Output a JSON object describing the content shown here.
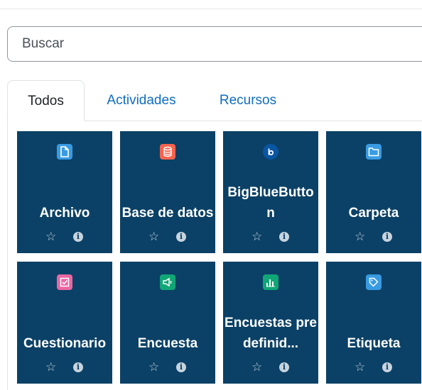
{
  "search": {
    "placeholder": "Buscar",
    "value": ""
  },
  "tabs": [
    {
      "label": "Todos",
      "active": true
    },
    {
      "label": "Actividades",
      "active": false
    },
    {
      "label": "Recursos",
      "active": false
    }
  ],
  "modules": [
    {
      "name": "Archivo",
      "icon": "file-icon",
      "icon_color": "#399be2"
    },
    {
      "name": "Base de datos",
      "icon": "database-icon",
      "icon_color": "#f7634d"
    },
    {
      "name": "BigBlueButton",
      "icon": "bigbluebutton-icon",
      "icon_color": "#0a56a3"
    },
    {
      "name": "Carpeta",
      "icon": "folder-icon",
      "icon_color": "#399be2"
    },
    {
      "name": "Cuestionario",
      "icon": "quiz-icon",
      "icon_color": "#eb66a2"
    },
    {
      "name": "Encuesta",
      "icon": "survey-megaphone-icon",
      "icon_color": "#11a676"
    },
    {
      "name": "Encuestas predefinid...",
      "icon": "bar-chart-icon",
      "icon_color": "#11a676"
    },
    {
      "name": "Etiqueta",
      "icon": "tag-icon",
      "icon_color": "#399be2"
    }
  ],
  "tile_actions": {
    "star_icon": "star-outline-icon",
    "info_icon": "info-icon",
    "info_glyph": "i"
  }
}
